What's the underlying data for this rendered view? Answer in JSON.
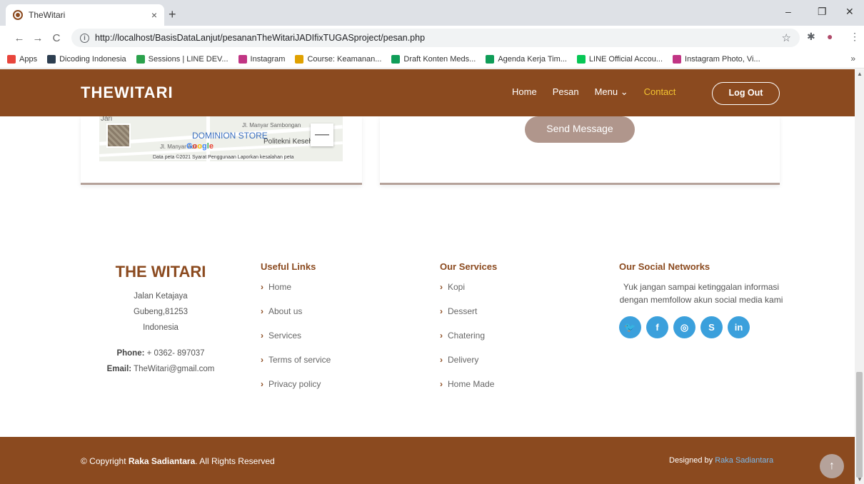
{
  "browser": {
    "tab_title": "TheWitari",
    "tab_close": "×",
    "new_tab": "+",
    "url": "http://localhost/BasisDataLanjut/pesananTheWitariJADIfixTUGASproject/pesan.php",
    "win_min": "–",
    "win_max": "❐",
    "win_close": "✕",
    "back": "←",
    "forward": "→",
    "reload": "C",
    "star": "☆",
    "bookmarks": [
      {
        "label": "Apps",
        "color": "#e8453c"
      },
      {
        "label": "Dicoding Indonesia",
        "color": "#2d3e50"
      },
      {
        "label": "Sessions | LINE DEV...",
        "color": "#2ba24c"
      },
      {
        "label": "Instagram",
        "color": "#c13584"
      },
      {
        "label": "Course: Keamanan...",
        "color": "#e0a100"
      },
      {
        "label": "Draft Konten Meds...",
        "color": "#0f9d58"
      },
      {
        "label": "Agenda Kerja Tim...",
        "color": "#0f9d58"
      },
      {
        "label": "LINE Official Accou...",
        "color": "#06c755"
      },
      {
        "label": "Instagram Photo, Vi...",
        "color": "#c13584"
      }
    ],
    "more": "»"
  },
  "header": {
    "logo": "THEWITARI",
    "nav": [
      {
        "label": "Home",
        "active": false
      },
      {
        "label": "Pesan",
        "active": false
      },
      {
        "label": "Menu ⌄",
        "active": false
      },
      {
        "label": "Contact",
        "active": true
      }
    ],
    "logout": "Log Out"
  },
  "map": {
    "labels": [
      "Jl. Manyar Sambongan",
      "Jl. Manyar Adi",
      "Jari"
    ],
    "store": "DOMINION STORE",
    "google": "Google",
    "poi": "Politekni Kesehatan",
    "footer": "Data peta ©2021   Syarat Penggunaan   Laporkan kesalahan peta",
    "zoom_out": "—"
  },
  "form": {
    "send_button": "Send Message"
  },
  "footer": {
    "brand": {
      "name": "THE WITARI",
      "address": [
        "Jalan Ketajaya",
        "Gubeng,81253",
        "Indonesia"
      ],
      "phone_label": "Phone:",
      "phone": "+ 0362- 897037",
      "email_label": "Email:",
      "email": "TheWitari@gmail.com"
    },
    "useful_links": {
      "title": "Useful Links",
      "items": [
        "Home",
        "About us",
        "Services",
        "Terms of service",
        "Privacy policy"
      ]
    },
    "services": {
      "title": "Our Services",
      "items": [
        "Kopi",
        "Dessert",
        "Chatering",
        "Delivery",
        "Home Made"
      ]
    },
    "social": {
      "title": "Our Social Networks",
      "text": "Yuk jangan sampai ketinggalan informasi dengan memfollow akun social media kami",
      "icons": [
        {
          "name": "twitter-icon",
          "glyph": "🐦"
        },
        {
          "name": "facebook-icon",
          "glyph": "f"
        },
        {
          "name": "instagram-icon",
          "glyph": "◎"
        },
        {
          "name": "skype-icon",
          "glyph": "S"
        },
        {
          "name": "linkedin-icon",
          "glyph": "in"
        }
      ],
      "color": "#3ba0dc"
    },
    "bottom": {
      "copy_prefix": "© Copyright",
      "copy_name": "Raka Sadiantara",
      "copy_suffix": ". All Rights Reserved",
      "designed_prefix": "Designed by",
      "designed_name": "Raka Sadiantara",
      "to_top": "↑"
    }
  },
  "colors": {
    "brand": "#8b4a1f",
    "accent": "#f4c430"
  }
}
